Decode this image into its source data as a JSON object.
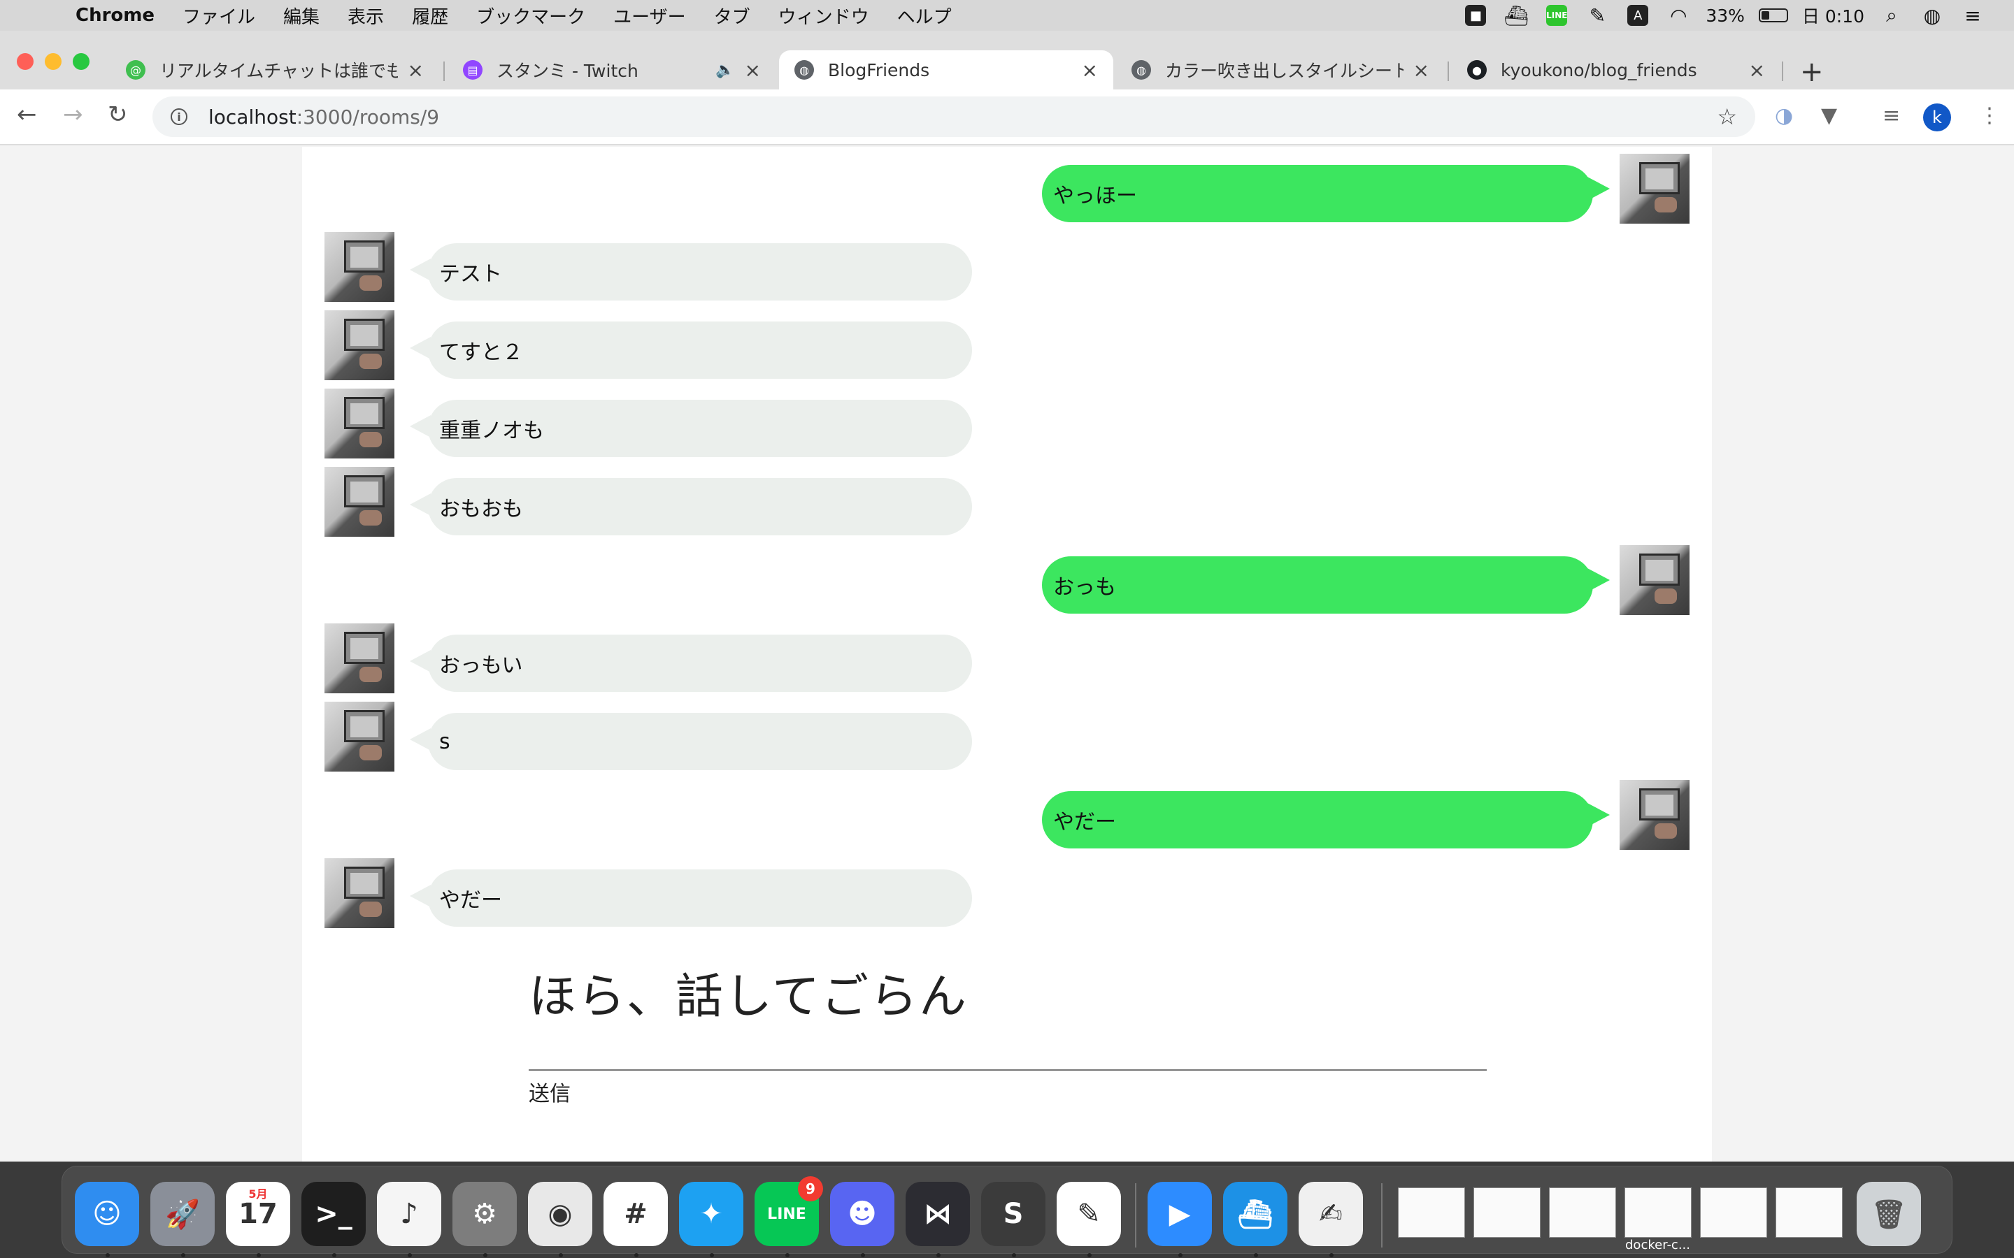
{
  "menubar": {
    "app_name": "Chrome",
    "menus": [
      "ファイル",
      "編集",
      "表示",
      "履歴",
      "ブックマーク",
      "ユーザー",
      "タブ",
      "ウィンドウ",
      "ヘルプ"
    ],
    "status": {
      "line_label": "LINE",
      "input_label": "A",
      "battery_percent": "33%",
      "battery_level": 0.33,
      "datetime": "日 0:10"
    }
  },
  "browser": {
    "tabs": [
      {
        "title": "リアルタイムチャットは誰でもつく",
        "favicon": "at-sign-icon",
        "color": "#3fbf4f"
      },
      {
        "title": "スタンミ - Twitch",
        "favicon": "twitch-icon",
        "color": "#9146ff",
        "audio": "🔈"
      },
      {
        "title": "BlogFriends",
        "favicon": "globe-icon",
        "color": "#5f6368",
        "active": true
      },
      {
        "title": "カラー吹き出しスタイルシートCSS",
        "favicon": "globe-icon",
        "color": "#5f6368"
      },
      {
        "title": "kyoukono/blog_friends",
        "favicon": "github-icon",
        "color": "#1b1f23"
      }
    ],
    "new_tab_label": "+",
    "url_host": "localhost",
    "url_path": ":3000/rooms/9",
    "profile_initial": "k"
  },
  "chat": {
    "messages": [
      {
        "side": "mine",
        "text": "やっほー"
      },
      {
        "side": "theirs",
        "text": "テスト"
      },
      {
        "side": "theirs",
        "text": "てすと２"
      },
      {
        "side": "theirs",
        "text": "重重ノオも"
      },
      {
        "side": "theirs",
        "text": "おもおも"
      },
      {
        "side": "mine",
        "text": "おっも"
      },
      {
        "side": "theirs",
        "text": "おっもい"
      },
      {
        "side": "theirs",
        "text": "s"
      },
      {
        "side": "mine",
        "text": "やだー"
      },
      {
        "side": "theirs",
        "text": "やだー"
      }
    ],
    "prompt_title": "ほら、話してごらん",
    "input_value": "",
    "send_label": "送信"
  },
  "dock": {
    "apps": [
      {
        "name": "finder-icon",
        "color": "#2f8df0",
        "glyph": "☺"
      },
      {
        "name": "launchpad-icon",
        "color": "#8a8f99",
        "glyph": "🚀"
      },
      {
        "name": "calendar-icon",
        "color": "#ffffff",
        "glyph": "17",
        "month": "5月"
      },
      {
        "name": "terminal-icon",
        "color": "#1e1e1e",
        "glyph": ">_"
      },
      {
        "name": "music-icon",
        "color": "#f5f5f5",
        "glyph": "♪"
      },
      {
        "name": "system-preferences-icon",
        "color": "#7d7d7d",
        "glyph": "⚙"
      },
      {
        "name": "chrome-icon",
        "color": "#e8e8e8",
        "glyph": "◉"
      },
      {
        "name": "slack-icon",
        "color": "#ffffff",
        "glyph": "#"
      },
      {
        "name": "twitter-icon",
        "color": "#1da1f2",
        "glyph": "✦"
      },
      {
        "name": "line-icon",
        "color": "#06c755",
        "glyph": "LINE",
        "badge": "9"
      },
      {
        "name": "discord-icon",
        "color": "#5865f2",
        "glyph": "☻"
      },
      {
        "name": "vscode-icon",
        "color": "#2c2c32",
        "glyph": "⋈"
      },
      {
        "name": "sublime-icon",
        "color": "#3b3b3b",
        "glyph": "S"
      },
      {
        "name": "evernote-icon",
        "color": "#ffffff",
        "glyph": "✎"
      },
      {
        "name": "zoom-icon",
        "color": "#2d8cff",
        "glyph": "▶"
      },
      {
        "name": "docker-icon",
        "color": "#1d91e6",
        "glyph": "⛴"
      },
      {
        "name": "textedit-icon",
        "color": "#f0f0f0",
        "glyph": "✍"
      }
    ],
    "window_thumbs": [
      "",
      "",
      "",
      "docker-c...",
      "",
      ""
    ]
  }
}
